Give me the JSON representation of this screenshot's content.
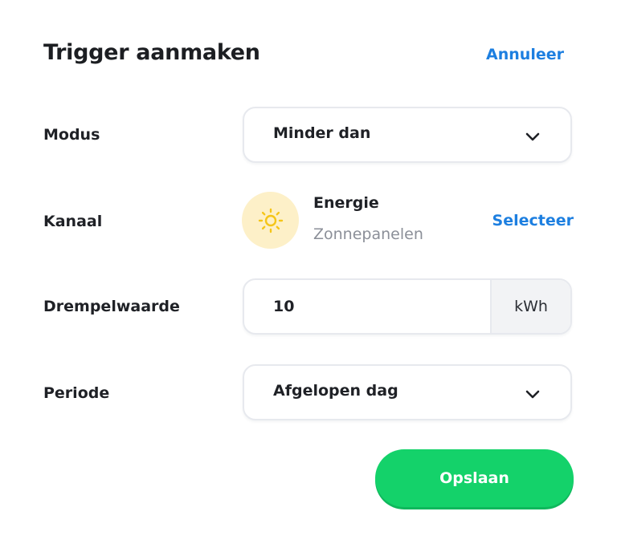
{
  "header": {
    "title": "Trigger aanmaken",
    "cancel_label": "Annuleer"
  },
  "form": {
    "mode": {
      "label": "Modus",
      "value": "Minder dan"
    },
    "channel": {
      "label": "Kanaal",
      "name": "Energie",
      "subtitle": "Zonnepanelen",
      "icon": "sun-icon",
      "select_label": "Selecteer"
    },
    "threshold": {
      "label": "Drempelwaarde",
      "value": "10",
      "unit": "kWh"
    },
    "period": {
      "label": "Periode",
      "value": "Afgelopen dag"
    }
  },
  "actions": {
    "save_label": "Opslaan"
  },
  "colors": {
    "accent_link": "#1d7fe0",
    "save_button": "#14d26a",
    "sun_background": "#fdf0c8",
    "sun_icon": "#f5c518"
  }
}
